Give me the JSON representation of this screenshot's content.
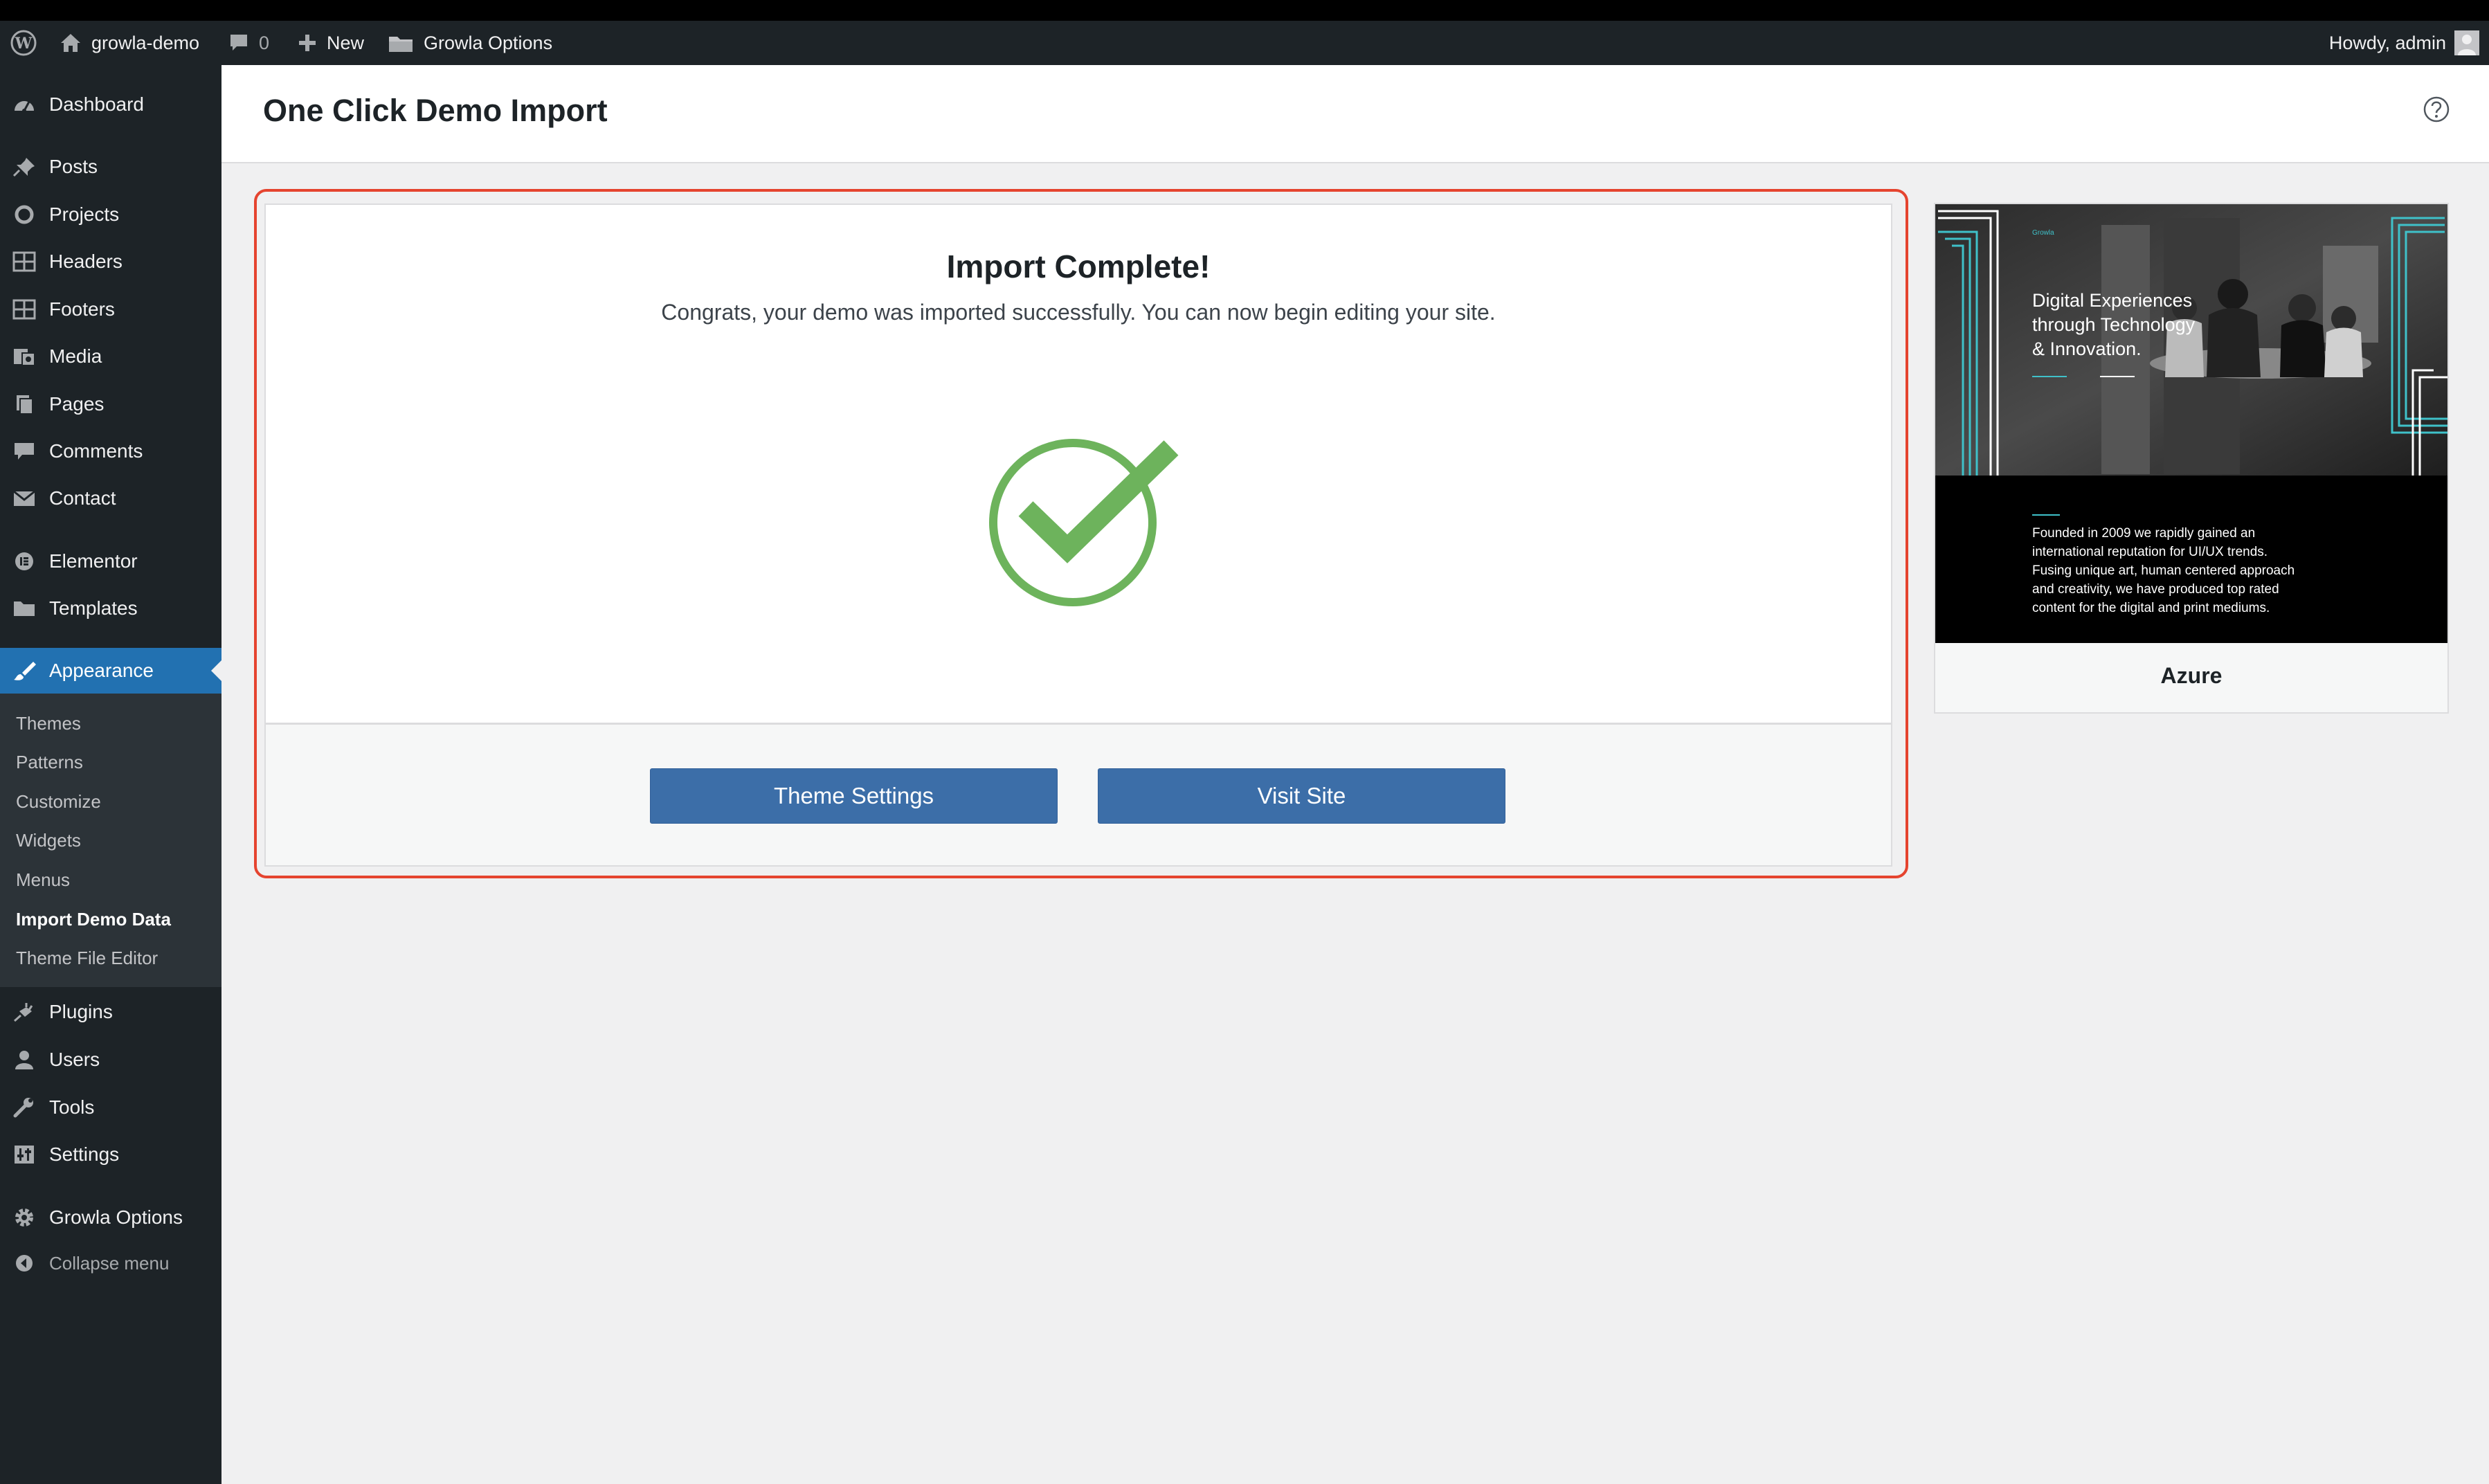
{
  "admin_bar": {
    "wp_logo": "wordpress-icon",
    "site_name": "growla-demo",
    "comments_count": "0",
    "new_label": "New",
    "growla_options": "Growla Options",
    "howdy": "Howdy, admin"
  },
  "sidebar": {
    "items": [
      {
        "label": "Dashboard",
        "icon": "dashboard-icon"
      },
      {
        "label": "Posts",
        "icon": "pushpin-icon"
      },
      {
        "label": "Projects",
        "icon": "circle-icon"
      },
      {
        "label": "Headers",
        "icon": "table-icon"
      },
      {
        "label": "Footers",
        "icon": "table-icon"
      },
      {
        "label": "Media",
        "icon": "media-icon"
      },
      {
        "label": "Pages",
        "icon": "pages-icon"
      },
      {
        "label": "Comments",
        "icon": "comment-icon"
      },
      {
        "label": "Contact",
        "icon": "envelope-icon"
      },
      {
        "label": "Elementor",
        "icon": "elementor-icon"
      },
      {
        "label": "Templates",
        "icon": "folder-icon"
      },
      {
        "label": "Appearance",
        "icon": "paintbrush-icon"
      },
      {
        "label": "Plugins",
        "icon": "plug-icon"
      },
      {
        "label": "Users",
        "icon": "user-icon"
      },
      {
        "label": "Tools",
        "icon": "wrench-icon"
      },
      {
        "label": "Settings",
        "icon": "settings-icon"
      },
      {
        "label": "Growla Options",
        "icon": "gear-icon"
      }
    ],
    "submenu": [
      "Themes",
      "Patterns",
      "Customize",
      "Widgets",
      "Menus",
      "Import Demo Data",
      "Theme File Editor"
    ],
    "collapse_label": "Collapse menu"
  },
  "page": {
    "title": "One Click Demo Import",
    "help_icon": "help-icon"
  },
  "import": {
    "title": "Import Complete!",
    "message": "Congrats, your demo was imported successfully. You can now begin editing your site.",
    "theme_settings_button": "Theme Settings",
    "visit_site_button": "Visit Site"
  },
  "demo": {
    "name": "Azure",
    "preview": {
      "brand": "Growla",
      "headline_1": "Digital Experiences",
      "headline_2": "through Technology",
      "headline_3": "& Innovation.",
      "body_1": "Founded in 2009 we rapidly gained an",
      "body_2": "international reputation for UI/UX trends.",
      "body_3": "Fusing unique art, human centered approach",
      "body_4": "and creativity, we have produced top rated",
      "body_5": "content for the digital and print mediums."
    }
  },
  "colors": {
    "accent": "#2271b1",
    "button": "#3c6ea8",
    "success": "#6db35c",
    "highlight": "#e5442f",
    "admin_dark": "#1d2327"
  }
}
